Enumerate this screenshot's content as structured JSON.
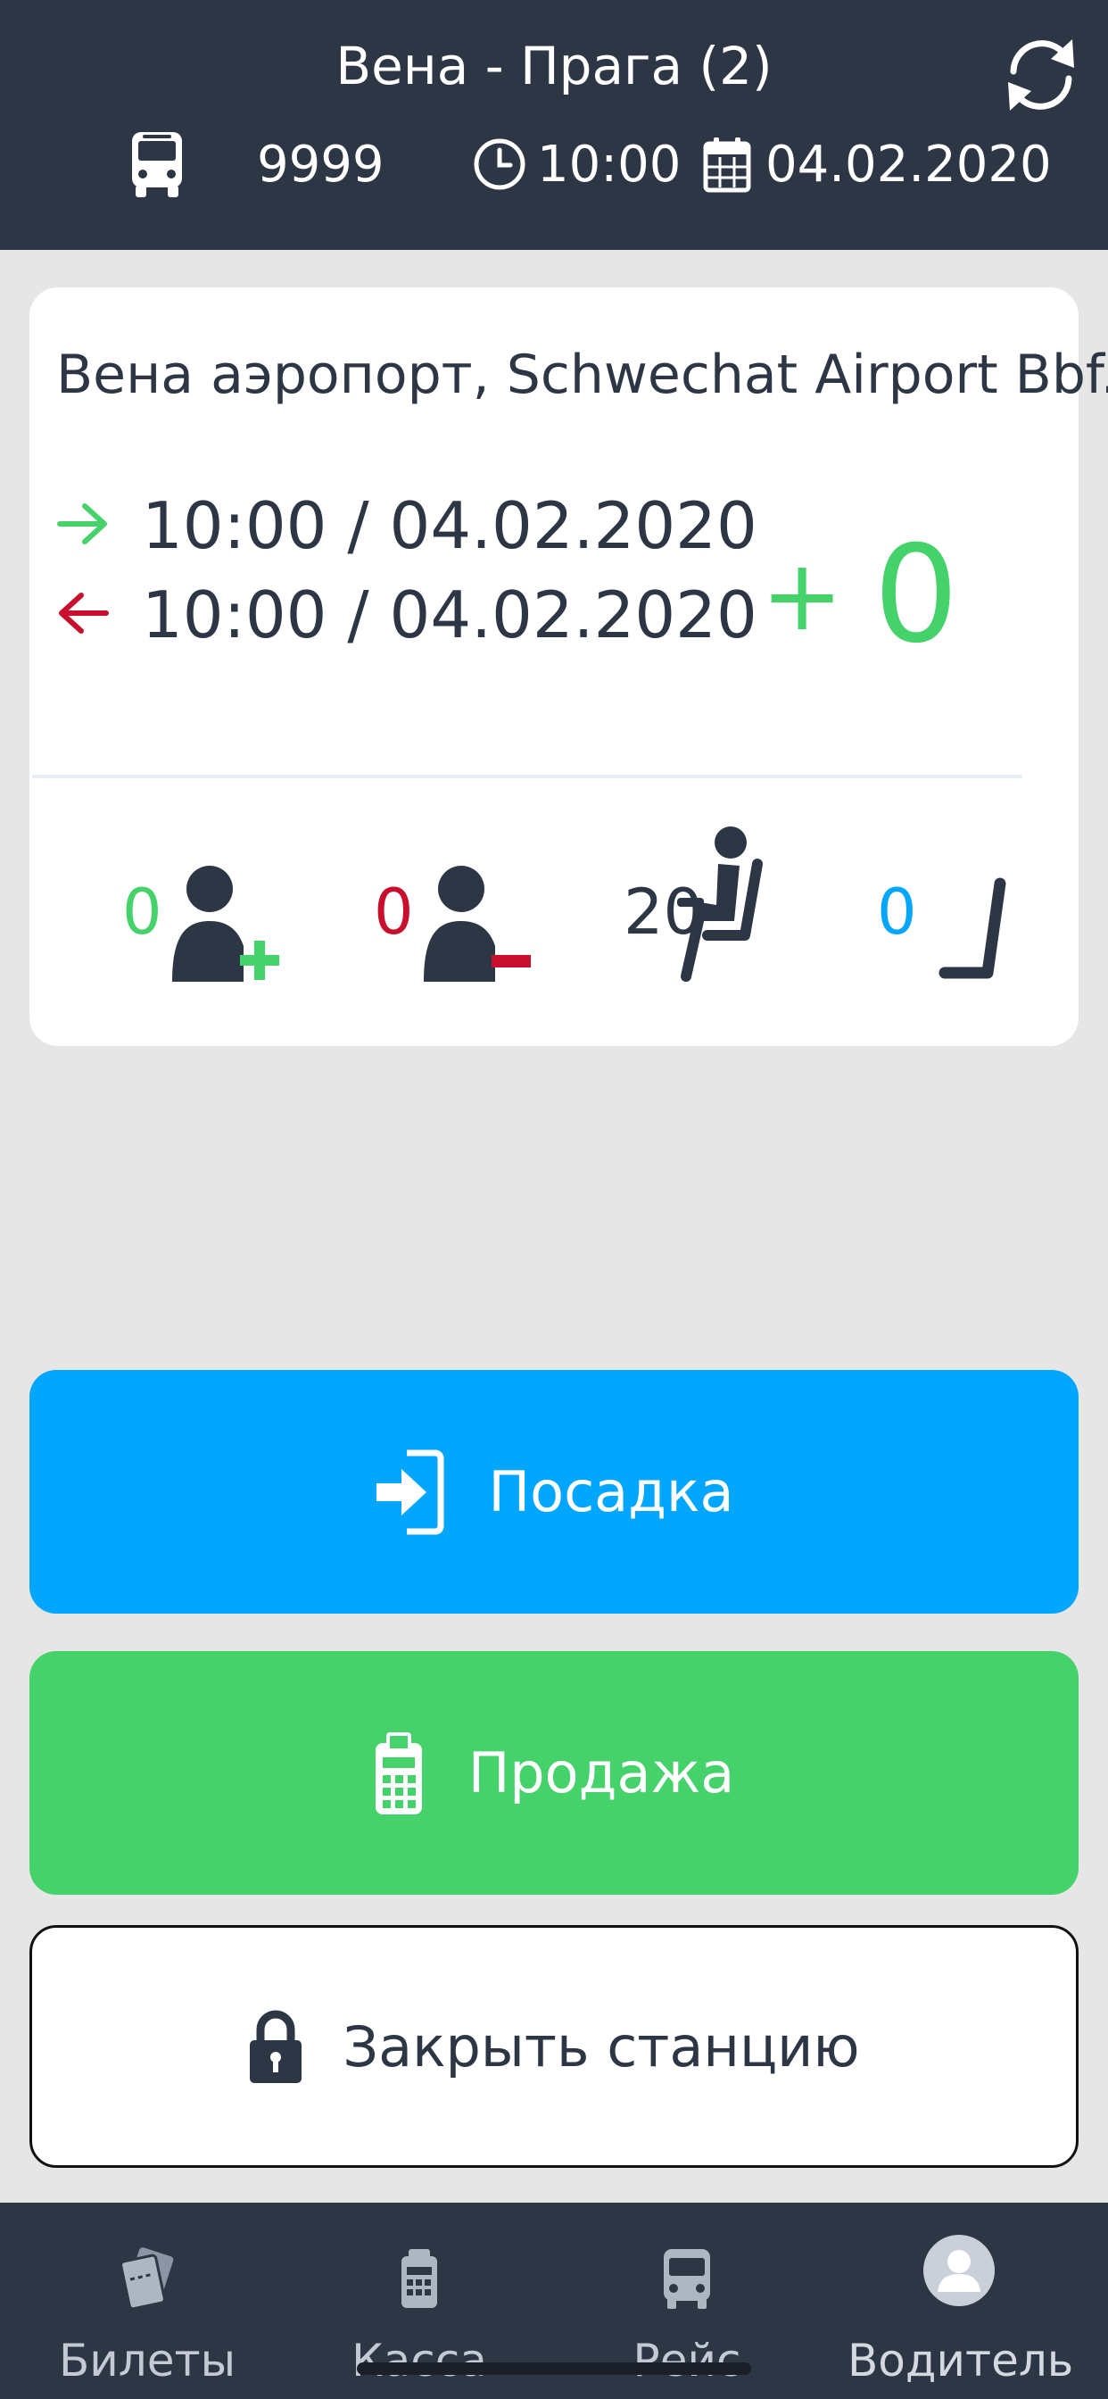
{
  "header": {
    "title": "Вена - Прага (2)",
    "bus_number": "9999",
    "time": "10:00",
    "date": "04.02.2020"
  },
  "station": {
    "name": "Вена аэропорт, Schwechat Airport Bbf.",
    "arrival": "10:00 / 04.02.2020",
    "departure": "10:00 / 04.02.2020",
    "balance_sign": "+",
    "balance_value": "0"
  },
  "stats": {
    "boarding": "0",
    "alighting": "0",
    "seated": "20",
    "free_seats": "0"
  },
  "actions": {
    "board_label": "Посадка",
    "sell_label": "Продажа",
    "close_label": "Закрыть станцию"
  },
  "tabs": [
    {
      "label": "Билеты",
      "icon": "tickets-icon"
    },
    {
      "label": "Касса",
      "icon": "cash-register-icon"
    },
    {
      "label": "Рейс",
      "icon": "bus-icon"
    },
    {
      "label": "Водитель",
      "icon": "driver-avatar-icon"
    }
  ],
  "colors": {
    "header_bg": "#2d3644",
    "page_bg": "#e6e6e6",
    "green": "#45d26b",
    "red": "#c8102e",
    "blue": "#03a6fd",
    "dark": "#2d3644"
  }
}
